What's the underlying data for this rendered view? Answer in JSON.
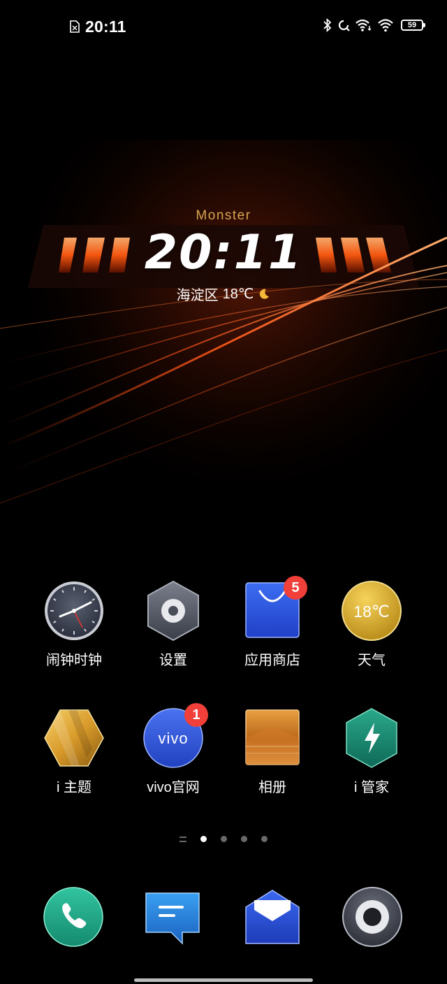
{
  "status_bar": {
    "time": "20:11",
    "battery": "59",
    "icons": [
      "sim-card-icon",
      "bluetooth-icon",
      "hotspot-icon",
      "wifi-calling-icon",
      "wifi-icon",
      "battery-icon"
    ]
  },
  "widget": {
    "brand": "Monster",
    "time": "20:11",
    "location": "海淀区",
    "temperature": "18℃",
    "weather_icon": "moon-icon"
  },
  "apps": [
    {
      "label": "闹钟时钟",
      "icon": "clock-icon"
    },
    {
      "label": "设置",
      "icon": "settings-icon"
    },
    {
      "label": "应用商店",
      "icon": "app-store-icon",
      "badge": "5"
    },
    {
      "label": "天气",
      "icon": "weather-icon",
      "icon_text": "18℃"
    },
    {
      "label": "i 主题",
      "icon": "themes-icon"
    },
    {
      "label": "vivo官网",
      "icon": "vivo-icon",
      "icon_text": "vivo",
      "badge": "1"
    },
    {
      "label": "相册",
      "icon": "album-icon"
    },
    {
      "label": "i 管家",
      "icon": "iManager-icon"
    }
  ],
  "pages": {
    "count": 4,
    "active": 1
  },
  "dock": [
    "phone-icon",
    "messages-icon",
    "email-icon",
    "camera-icon"
  ],
  "colors": {
    "accent_orange": "#ff5a1a",
    "brand_gold": "#d8a553",
    "badge_red": "#f1403a"
  }
}
